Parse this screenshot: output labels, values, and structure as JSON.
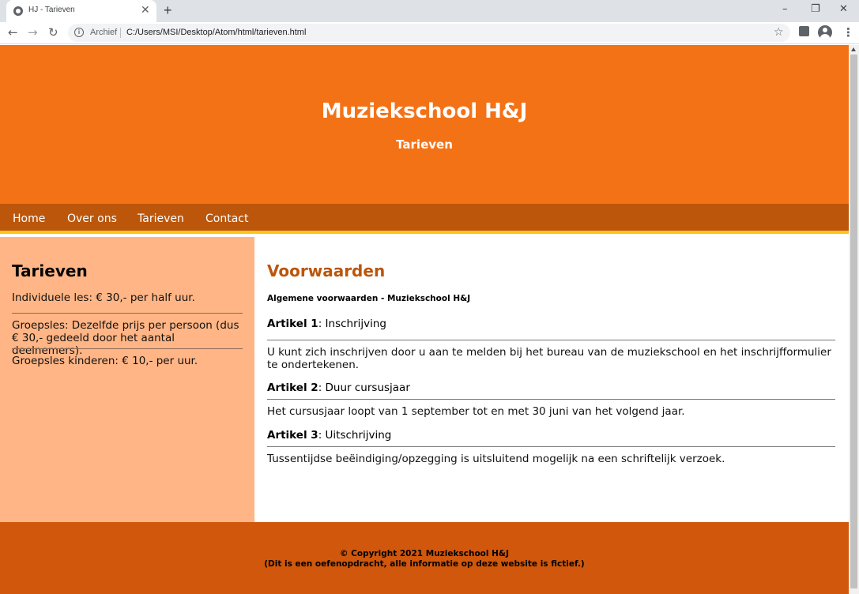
{
  "browser": {
    "tab_title": "HJ - Tarieven",
    "new_tab_symbol": "+",
    "address_label": "Archief",
    "url": "C:/Users/MSI/Desktop/Atom/html/tarieven.html"
  },
  "header": {
    "title": "Muziekschool H&J",
    "subtitle": "Tarieven"
  },
  "nav": {
    "items": [
      "Home",
      "Over ons",
      "Tarieven",
      "Contact"
    ]
  },
  "sidebar": {
    "title": "Tarieven",
    "items": [
      "Individuele les: € 30,- per half uur.",
      "Groepsles: Dezelfde prijs per persoon (dus € 30,- gedeeld door het aantal deelnemers).",
      "Groepsles kinderen: € 10,- per uur."
    ]
  },
  "main": {
    "title": "Voorwaarden",
    "subtitle": "Algemene voorwaarden - Muziekschool H&J",
    "articles": [
      {
        "label": "Artikel 1",
        "heading": ": Inschrijving",
        "text": "U kunt zich inschrijven door u aan te melden bij het bureau van de muziekschool en het inschrijfformulier te ondertekenen."
      },
      {
        "label": "Artikel 2",
        "heading": ": Duur cursusjaar",
        "text": "Het cursusjaar loopt van 1 september tot en met 30 juni van het volgend jaar."
      },
      {
        "label": "Artikel 3",
        "heading": ": Uitschrijving",
        "text": "Tussentijdse beëindiging/opzegging is uitsluitend mogelijk na een schriftelijk verzoek."
      }
    ]
  },
  "footer": {
    "copyright": "© Copyright 2021 Muziekschool H&J",
    "note": "(Dit is een oefenopdracht, alle informatie op deze website is fictief.)"
  },
  "colors": {
    "header_bg": "#f47216",
    "nav_bg": "#bb560b",
    "nav_border": "#fbc41c",
    "sidebar_bg": "#ffb585",
    "main_title": "#bb560b",
    "footer_bg": "#d0570c"
  }
}
